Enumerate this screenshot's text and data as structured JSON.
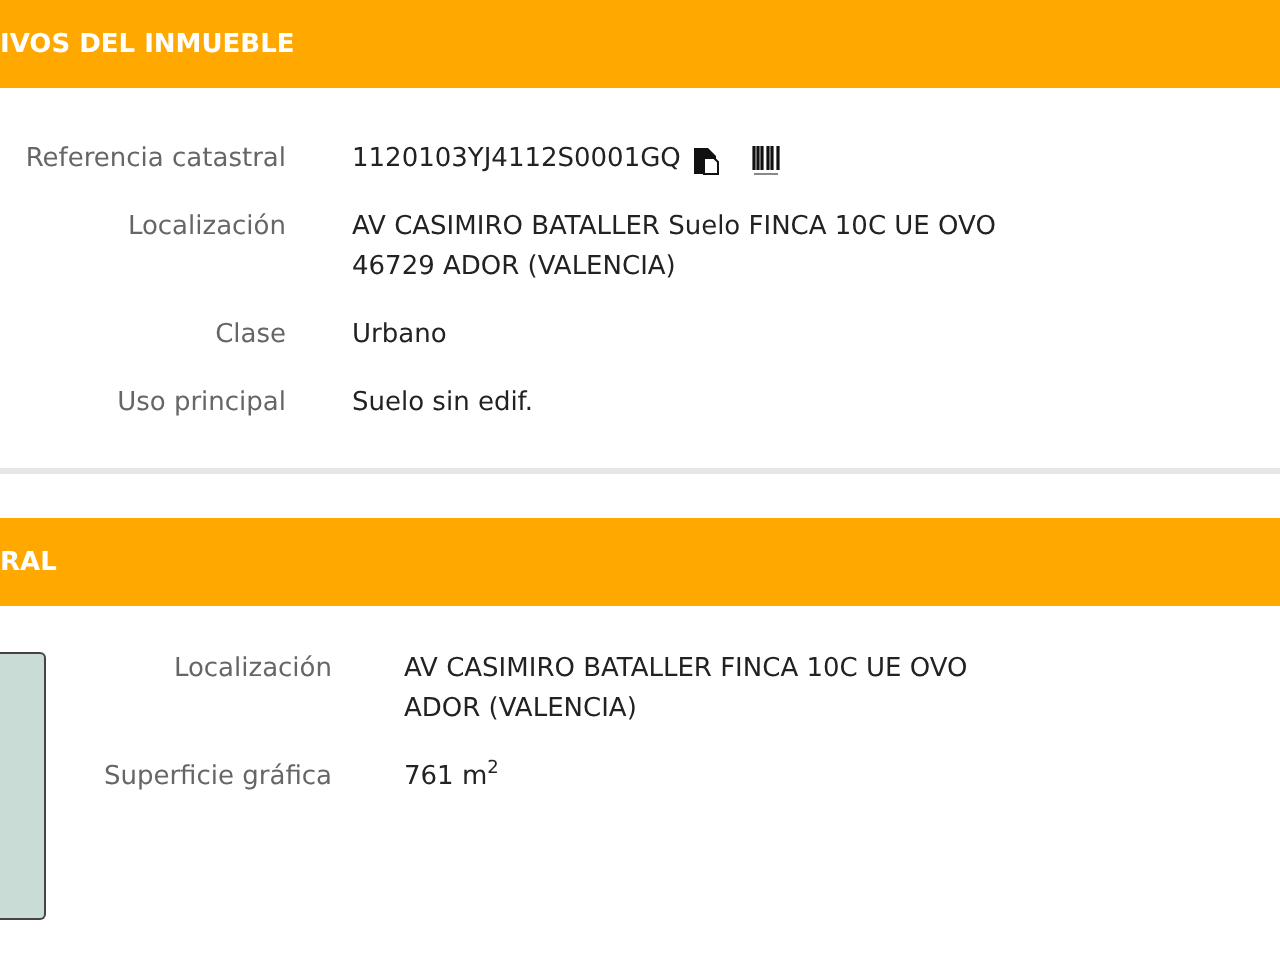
{
  "sections": [
    {
      "title": "IVOS DEL INMUEBLE",
      "map_panel": false,
      "fields": [
        {
          "label": "Referencia catastral",
          "lines": [
            "1120103YJ4112S0001GQ"
          ],
          "icons": true
        },
        {
          "label": "Localización",
          "lines": [
            "AV CASIMIRO BATALLER Suelo FINCA 10C UE OVO",
            "46729 ADOR (VALENCIA)"
          ],
          "icons": false
        },
        {
          "label": "Clase",
          "lines": [
            "Urbano"
          ],
          "icons": false
        },
        {
          "label": "Uso principal",
          "lines": [
            "Suelo sin edif."
          ],
          "icons": false
        }
      ]
    },
    {
      "title": "RAL",
      "map_panel": true,
      "fields": [
        {
          "label": "Localización",
          "lines": [
            "AV CASIMIRO BATALLER FINCA 10C UE OVO",
            "ADOR (VALENCIA)"
          ],
          "icons": false
        },
        {
          "label": "Superficie gráfica",
          "lines": [
            "761 m$^{2}$"
          ],
          "icons": false
        }
      ]
    }
  ]
}
